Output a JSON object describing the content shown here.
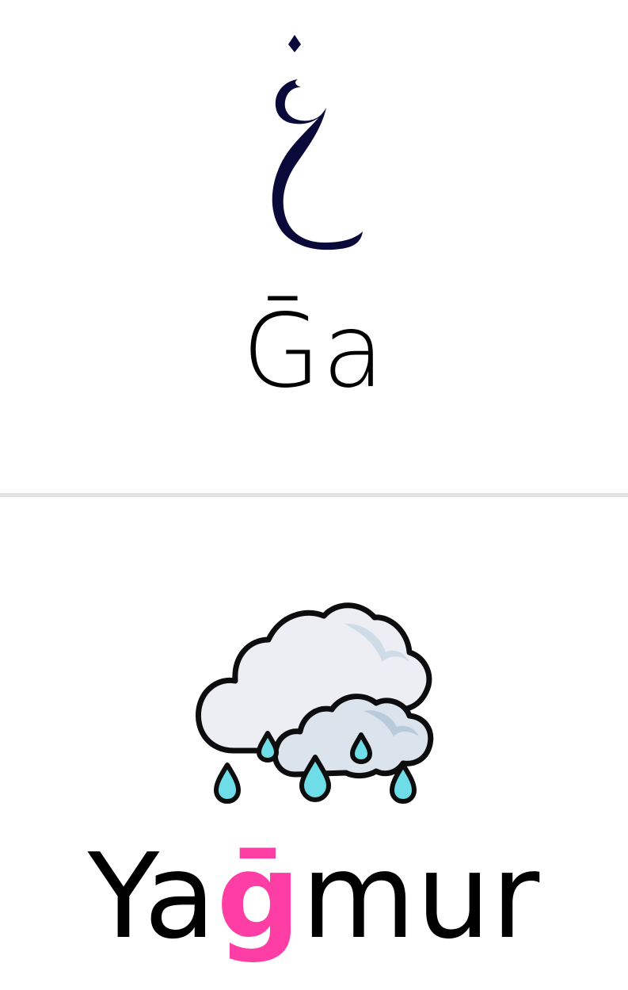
{
  "letter": {
    "glyph": "غ",
    "glyph_color": "#0a0a3a",
    "transliteration": "Ḡa"
  },
  "example": {
    "word_before": "Ya",
    "word_highlight": "ḡ",
    "word_after": "mur",
    "highlight_color": "#ff3ea5",
    "illustration": "rain-cloud-icon"
  },
  "colors": {
    "divider": "#e3e3e3",
    "cloud_fill": "#eceef3",
    "cloud_shade": "#cfdbe6",
    "raindrop_fill": "#6fdde8"
  }
}
